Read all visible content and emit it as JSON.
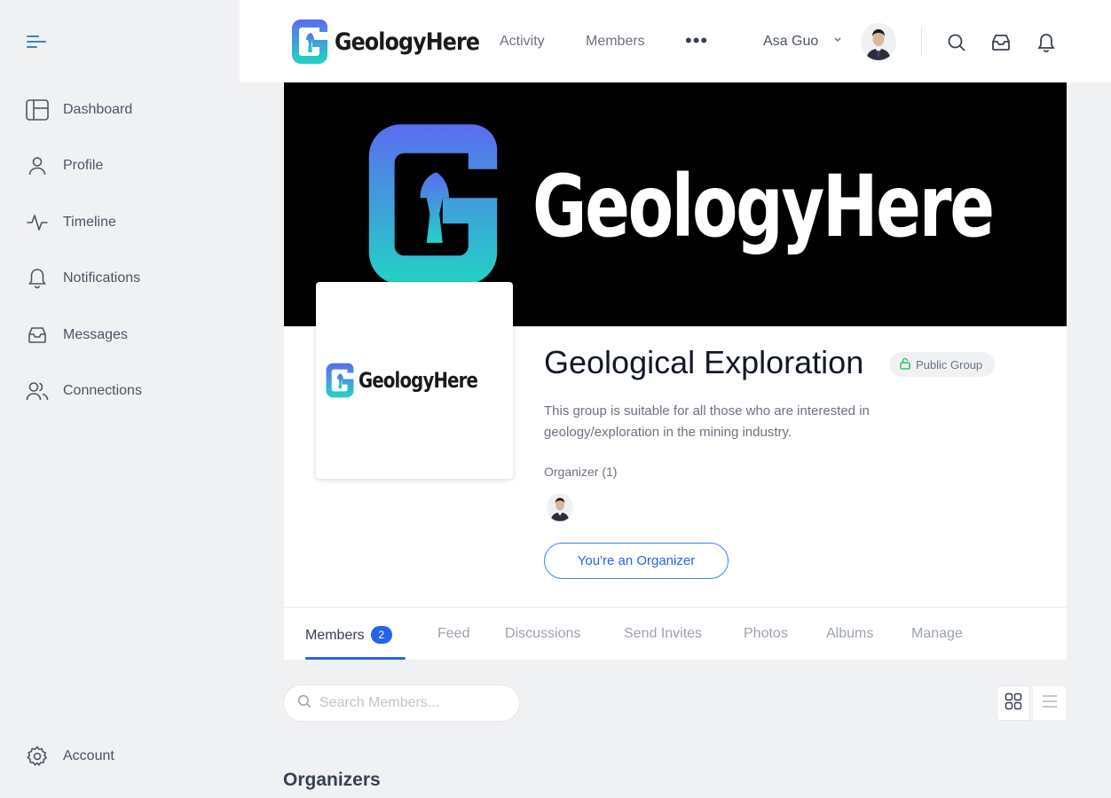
{
  "sidebar": {
    "items": [
      {
        "label": "Dashboard",
        "icon": "dashboard-icon"
      },
      {
        "label": "Profile",
        "icon": "profile-icon"
      },
      {
        "label": "Timeline",
        "icon": "timeline-icon"
      },
      {
        "label": "Notifications",
        "icon": "bell-icon"
      },
      {
        "label": "Messages",
        "icon": "inbox-icon"
      },
      {
        "label": "Connections",
        "icon": "users-icon"
      }
    ],
    "account_label": "Account"
  },
  "header": {
    "brand": "GeologyHere",
    "nav": [
      "Activity",
      "Members"
    ],
    "more": "•••",
    "user_name": "Asa Guo"
  },
  "cover": {
    "brand_text": "GeologyHere"
  },
  "group": {
    "logo_text": "GeologyHere",
    "title": "Geological Exploration",
    "badge": "Public Group",
    "description": "This group is suitable for all those who are interested in geology/exploration in the mining industry.",
    "organizer_label": "Organizer (1)",
    "organizer_button": "You're an Organizer"
  },
  "tabs": [
    {
      "label": "Members",
      "count": "2"
    },
    {
      "label": "Feed"
    },
    {
      "label": "Discussions"
    },
    {
      "label": "Send Invites"
    },
    {
      "label": "Photos"
    },
    {
      "label": "Albums"
    },
    {
      "label": "Manage"
    }
  ],
  "search": {
    "placeholder": "Search Members..."
  },
  "section_title": "Organizers",
  "colors": {
    "accent": "#2563eb",
    "logo_gradient_top": "#5b6cf0",
    "logo_gradient_bottom": "#22d3c5"
  }
}
